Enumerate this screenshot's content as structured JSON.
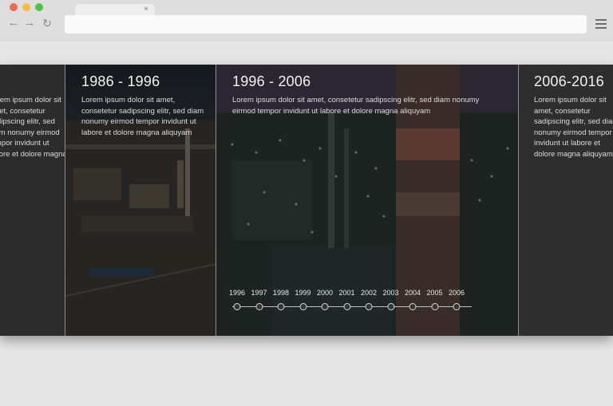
{
  "browser": {
    "tab_close": "×",
    "back_icon": "←",
    "forward_icon": "→",
    "reload_icon": "↻"
  },
  "timeline": {
    "panels": [
      {
        "title": "",
        "text": "Lorem ipsum dolor sit amet, consetetur sadipscing elitr, sed diam nonumy eirmod tempor invidunt ut labore et dolore magna"
      },
      {
        "title": "1986 - 1996",
        "text": "Lorem ipsum dolor sit amet, consetetur sadipscing elitr, sed diam nonumy eirmod tempor invidunt ut labore et dolore magna aliquyam"
      },
      {
        "title": "1996 - 2006",
        "text": "Lorem ipsum dolor sit amet, consetetur sadipscing elitr, sed diam nonumy eirmod tempor invidunt ut labore et dolore magna aliquyam"
      },
      {
        "title": "2006-2016",
        "text": "Lorem ipsum dolor sit amet, consetetur sadipscing elitr, sed diam nonumy eirmod tempor invidunt ut labore et dolore magna aliquyam"
      }
    ],
    "years": [
      "1996",
      "1997",
      "1998",
      "1999",
      "2000",
      "2001",
      "2002",
      "2003",
      "2004",
      "2005",
      "2006"
    ]
  }
}
